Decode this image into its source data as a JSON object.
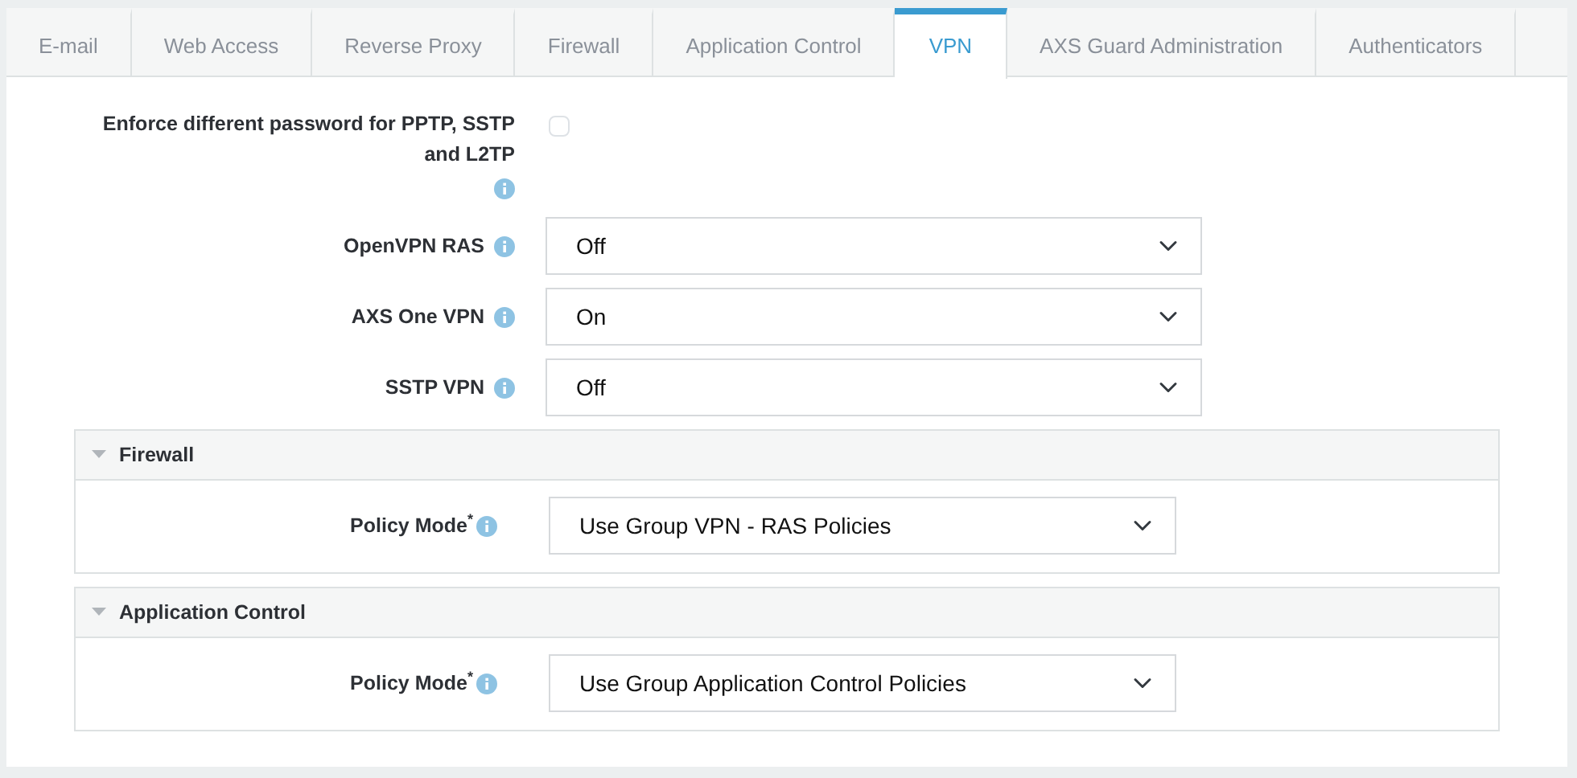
{
  "tabs": [
    {
      "label": "E-mail",
      "selected": false
    },
    {
      "label": "Web Access",
      "selected": false
    },
    {
      "label": "Reverse Proxy",
      "selected": false
    },
    {
      "label": "Firewall",
      "selected": false
    },
    {
      "label": "Application Control",
      "selected": false
    },
    {
      "label": "VPN",
      "selected": true
    },
    {
      "label": "AXS Guard Administration",
      "selected": false
    },
    {
      "label": "Authenticators",
      "selected": false
    }
  ],
  "settings": [
    {
      "kind": "checkbox",
      "label": "Enforce different password for PPTP, SSTP and L2TP",
      "checked": false
    },
    {
      "kind": "select",
      "label": "OpenVPN RAS",
      "value": "Off"
    },
    {
      "kind": "select",
      "label": "AXS One VPN",
      "value": "On"
    },
    {
      "kind": "select",
      "label": "SSTP VPN",
      "value": "Off"
    }
  ],
  "sections": [
    {
      "title": "Firewall",
      "expanded": true,
      "fields": [
        {
          "label": "Policy Mode$^{*}$",
          "value": "Use Group VPN - RAS Policies"
        }
      ]
    },
    {
      "title": "Application Control",
      "expanded": true,
      "fields": [
        {
          "label": "Policy Mode$^{*}$",
          "value": "Use Group Application Control Policies"
        }
      ]
    }
  ]
}
